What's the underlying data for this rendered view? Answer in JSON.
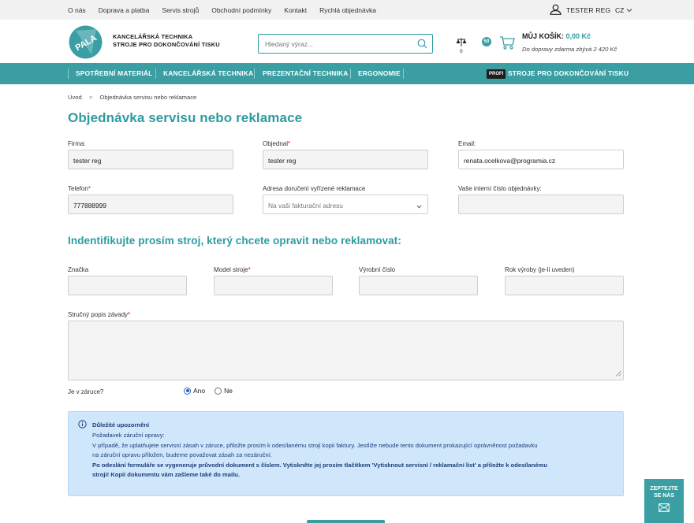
{
  "topbar": {
    "links": [
      "O nás",
      "Doprava a platba",
      "Servis strojů",
      "Obchodní podmínky",
      "Kontakt",
      "Rychlá objednávka"
    ],
    "user_name": "TESTER REG",
    "language": "CZ"
  },
  "header": {
    "logo_text": "PALA",
    "brand_line1": "KANCELÁŘSKÁ TECHNIKA",
    "brand_line2": "STROJE PRO DOKONČOVÁNÍ TISKU",
    "search_placeholder": "Hledaný výraz...",
    "compare_count": "0",
    "badge_50": "50",
    "cart_label": "MŮJ KOŠÍK:",
    "cart_price": "0,00 Kč",
    "cart_free_shipping": "Do dopravy zdarma zbývá 2 420 Kč"
  },
  "nav": {
    "items": [
      "SPOTŘEBNÍ MATERIÁL",
      "KANCELÁŘSKÁ TECHNIKA",
      "PREZENTAČNÍ TECHNIKA",
      "ERGONOMIE"
    ],
    "profi_badge": "PROFI",
    "profi_label": "STROJE PRO DOKONČOVÁNÍ TISKU"
  },
  "breadcrumb": {
    "home": "Úvod",
    "separator": ">",
    "current": "Objednávka servisu nebo reklamace"
  },
  "page_title": "Objednávka servisu nebo reklamace",
  "form": {
    "firma": {
      "label": "Firma:",
      "value": "tester reg"
    },
    "objednal": {
      "label": "Objednal",
      "value": "tester reg"
    },
    "email": {
      "label": "Email:",
      "value": "renata.ocelkova@programia.cz"
    },
    "telefon": {
      "label": "Telefon",
      "value": "777888999"
    },
    "adresa": {
      "label": "Adresa doručení vyřízené reklamace",
      "value": "Na vaši fakturační adresu"
    },
    "interni": {
      "label": "Vaše interní číslo objednávky:",
      "value": ""
    }
  },
  "machine_heading": "Indentifikujte prosím stroj, který chcete opravit nebo reklamovat:",
  "machine": {
    "znacka": {
      "label": "Značka",
      "value": ""
    },
    "model": {
      "label": "Model stroje",
      "value": ""
    },
    "vyrobni": {
      "label": "Výrobní číslo",
      "value": ""
    },
    "rok": {
      "label": "Rok výroby (je-li uveden)",
      "value": ""
    }
  },
  "popis": {
    "label": "Stručný popis závady",
    "value": ""
  },
  "warranty": {
    "label": "Je v záruce?",
    "options": [
      "Ano",
      "Ne"
    ],
    "selected": "Ano"
  },
  "notice": {
    "title": "Důležité upozornění",
    "line1": "Požadavek záruční opravy:",
    "line2": "V případě, že uplatňujete servisní zásah v záruce, přiložte prosím k odesílanému stroji kopii faktury. Jestliže nebude tento dokument prokazující oprávněnost požadavku",
    "line3": "na záruční opravu přiložen, budeme považovat zásah za nezáruční.",
    "line4": "Po odeslání formuláře se vygeneruje průvodní dokument s číslem. Vytiskněte jej prosím tlačítkem 'Vytisknout servisní / reklamační list' a přiložte k odesílanému",
    "line5": "stroji! Kopii dokumentu vám zašleme také do mailu."
  },
  "ask_widget": {
    "line1": "ZEPTEJTE",
    "line2": "SE NÁS"
  },
  "colors": {
    "accent": "#3a9ea3",
    "title": "#2e9ba0",
    "required": "#d11111",
    "notice_bg": "#cfe6fb"
  }
}
